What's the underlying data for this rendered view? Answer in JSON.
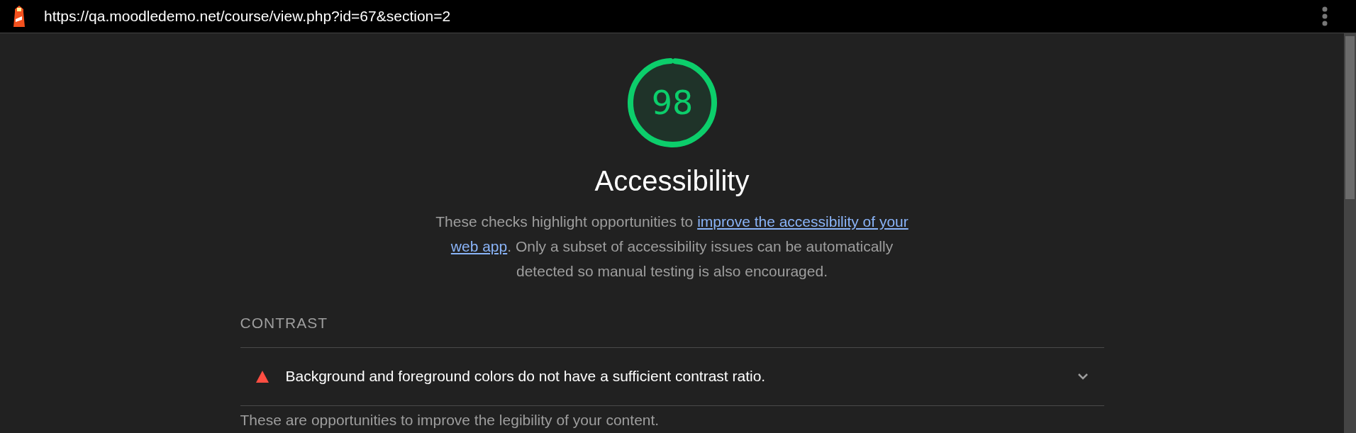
{
  "address_bar": {
    "url": "https://qa.moodledemo.net/course/view.php?id=67&section=2"
  },
  "score": {
    "value": "98",
    "level": 0.98
  },
  "category": {
    "title": "Accessibility",
    "description_before": "These checks highlight opportunities to ",
    "link_lines": [
      "improve the accessibility of your",
      "web app"
    ],
    "description_after": ". Only a subset of accessibility issues can be automatically detected so manual testing is also encouraged."
  },
  "group": {
    "title": "CONTRAST",
    "audits": [
      {
        "title": "Background and foreground colors do not have a sufficient contrast ratio.",
        "expanded": false
      }
    ],
    "description": "These are opportunities to improve the legibility of your content."
  }
}
